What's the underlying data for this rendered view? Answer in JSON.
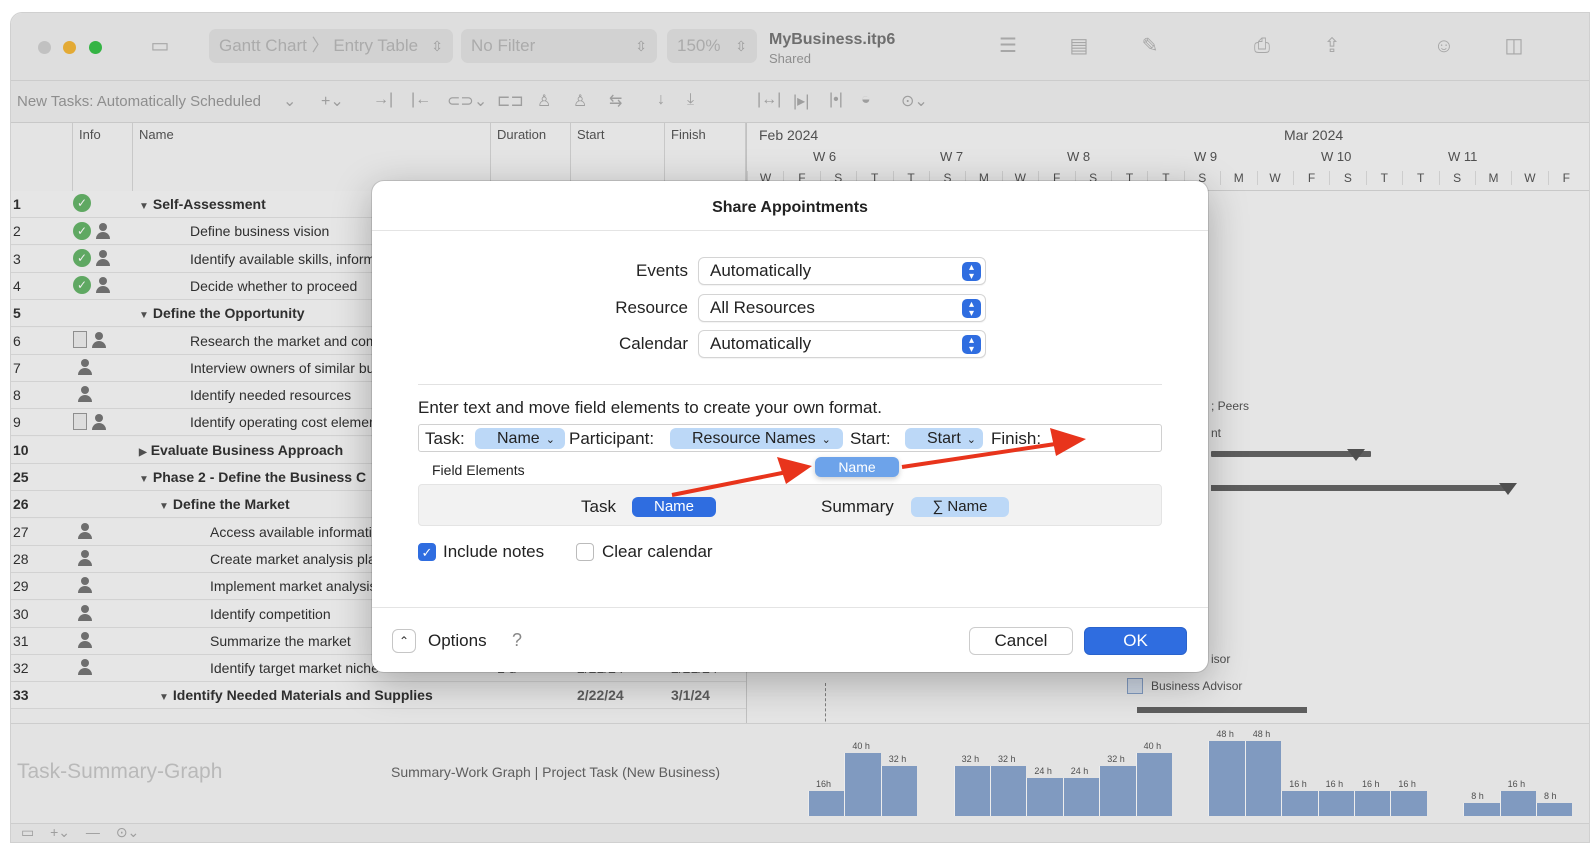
{
  "titlebar": {
    "view_popup": "Gantt Chart 〉 Entry Table",
    "filter_popup": "No Filter",
    "zoom_popup": "150%",
    "doc_title": "MyBusiness.itp6",
    "doc_subtitle": "Shared"
  },
  "toolbar2": {
    "mode_label": "New Tasks: Automatically Scheduled",
    "icons": [
      "add-icon",
      "indent-icon",
      "outdent-icon",
      "link-icon",
      "unlink-icon",
      "assign-resource-icon",
      "resource-icon",
      "leveling-icon",
      "arrow-down-icon",
      "import-icon",
      "bar-left-icon",
      "bar-right-icon",
      "bar-center-icon",
      "progress-icon",
      "more-icon"
    ]
  },
  "table": {
    "columns": [
      "Info",
      "Name",
      "Duration",
      "Start",
      "Finish"
    ],
    "rows": [
      {
        "num": "1",
        "name": "Self-Assessment",
        "bold": true,
        "indent": 0,
        "info": "check",
        "dur": "",
        "start": "",
        "finish": ""
      },
      {
        "num": "2",
        "name": "Define business vision",
        "bold": false,
        "indent": 1,
        "info": "check-person",
        "dur": "",
        "start": "",
        "finish": ""
      },
      {
        "num": "3",
        "name": "Identify available skills, informat",
        "bold": false,
        "indent": 1,
        "info": "check-person",
        "dur": "",
        "start": "",
        "finish": ""
      },
      {
        "num": "4",
        "name": "Decide whether to proceed",
        "bold": false,
        "indent": 1,
        "info": "check-person",
        "dur": "",
        "start": "",
        "finish": ""
      },
      {
        "num": "5",
        "name": "Define the Opportunity",
        "bold": true,
        "indent": 0,
        "info": "",
        "dur": "",
        "start": "",
        "finish": ""
      },
      {
        "num": "6",
        "name": "Research the market and comp",
        "bold": false,
        "indent": 1,
        "info": "note-person",
        "dur": "",
        "start": "",
        "finish": ""
      },
      {
        "num": "7",
        "name": "Interview owners of similar busi",
        "bold": false,
        "indent": 1,
        "info": "person",
        "dur": "",
        "start": "",
        "finish": ""
      },
      {
        "num": "8",
        "name": "Identify needed resources",
        "bold": false,
        "indent": 1,
        "info": "person",
        "dur": "",
        "start": "",
        "finish": ""
      },
      {
        "num": "9",
        "name": "Identify operating cost element",
        "bold": false,
        "indent": 1,
        "info": "note-person",
        "dur": "",
        "start": "",
        "finish": ""
      },
      {
        "num": "10",
        "name": "Evaluate Business Approach",
        "bold": true,
        "indent": 0,
        "info": "",
        "dur": "",
        "start": "",
        "finish": "",
        "collapsed": true
      },
      {
        "num": "25",
        "name": "Phase 2 - Define the Business C",
        "bold": true,
        "indent": 0,
        "info": "",
        "dur": "",
        "start": "",
        "finish": ""
      },
      {
        "num": "26",
        "name": "Define the Market",
        "bold": true,
        "indent": 1,
        "info": "",
        "dur": "",
        "start": "",
        "finish": ""
      },
      {
        "num": "27",
        "name": "Access available information",
        "bold": false,
        "indent": 2,
        "info": "person",
        "dur": "",
        "start": "",
        "finish": ""
      },
      {
        "num": "28",
        "name": "Create market analysis plan",
        "bold": false,
        "indent": 2,
        "info": "person",
        "dur": "",
        "start": "",
        "finish": ""
      },
      {
        "num": "29",
        "name": "Implement market analysis p",
        "bold": false,
        "indent": 2,
        "info": "person",
        "dur": "",
        "start": "",
        "finish": ""
      },
      {
        "num": "30",
        "name": "Identify competition",
        "bold": false,
        "indent": 2,
        "info": "person",
        "dur": "",
        "start": "",
        "finish": ""
      },
      {
        "num": "31",
        "name": "Summarize the market",
        "bold": false,
        "indent": 2,
        "info": "person",
        "dur": "",
        "start": "",
        "finish": ""
      },
      {
        "num": "32",
        "name": "Identify target market niche",
        "bold": false,
        "indent": 2,
        "info": "person",
        "dur": "1 d",
        "start": "2/21/24",
        "finish": "2/21/24"
      },
      {
        "num": "33",
        "name": "Identify Needed Materials and Supplies",
        "bold": true,
        "indent": 1,
        "info": "",
        "dur": "",
        "start": "2/22/24",
        "finish": "3/1/24"
      }
    ]
  },
  "gantt": {
    "months": [
      "Feb 2024",
      "Mar 2024"
    ],
    "weeks": [
      "W 6",
      "W 7",
      "W 8",
      "W 9",
      "W 10",
      "W 11"
    ],
    "days": [
      "W",
      "F",
      "S",
      "T",
      "T",
      "S",
      "M",
      "W",
      "F",
      "S",
      "T",
      "T",
      "S",
      "M",
      "W",
      "F",
      "S",
      "T",
      "T",
      "S",
      "M",
      "W",
      "F"
    ],
    "labels": [
      "; Peers",
      "nt",
      "isor",
      "Business Advisor"
    ]
  },
  "graph": {
    "label": "Task-Summary-Graph",
    "subtitle": "Summary-Work Graph | Project Task (New Business)",
    "bars": [
      {
        "label": "16h",
        "value": 16
      },
      {
        "label": "40 h",
        "value": 40
      },
      {
        "label": "32 h",
        "value": 32
      },
      {
        "label": "",
        "value": 0
      },
      {
        "label": "32 h",
        "value": 32
      },
      {
        "label": "32 h",
        "value": 32
      },
      {
        "label": "24 h",
        "value": 24
      },
      {
        "label": "24 h",
        "value": 24
      },
      {
        "label": "32 h",
        "value": 32
      },
      {
        "label": "40 h",
        "value": 40
      },
      {
        "label": "",
        "value": 0
      },
      {
        "label": "48 h",
        "value": 48
      },
      {
        "label": "48 h",
        "value": 48
      },
      {
        "label": "16 h",
        "value": 16
      },
      {
        "label": "16 h",
        "value": 16
      },
      {
        "label": "16 h",
        "value": 16
      },
      {
        "label": "16 h",
        "value": 16
      },
      {
        "label": "",
        "value": 0
      },
      {
        "label": "8 h",
        "value": 8
      },
      {
        "label": "16 h",
        "value": 16
      },
      {
        "label": "8 h",
        "value": 8
      }
    ]
  },
  "dialog": {
    "title": "Share Appointments",
    "events_label": "Events",
    "events_value": "Automatically",
    "resource_label": "Resource",
    "resource_value": "All Resources",
    "calendar_label": "Calendar",
    "calendar_value": "Automatically",
    "instruction": "Enter text and move field elements to create your own format.",
    "format": {
      "task_label": "Task:",
      "name_token": "Name",
      "participant_label": "Participant:",
      "resource_token": "Resource Names",
      "start_label": "Start:",
      "start_token": "Start",
      "finish_label": "Finish:"
    },
    "field_elements_label": "Field Elements",
    "fe_task_label": "Task",
    "fe_task_token": "Name",
    "fe_summary_label": "Summary",
    "fe_summary_token": "∑ Name",
    "dragging_token": "Name",
    "include_notes": "Include notes",
    "include_notes_checked": true,
    "clear_calendar": "Clear calendar",
    "clear_calendar_checked": false,
    "options_label": "Options",
    "help": "?",
    "cancel": "Cancel",
    "ok": "OK",
    "accent": "#2f6de0",
    "arrow_color": "#e8341c"
  }
}
